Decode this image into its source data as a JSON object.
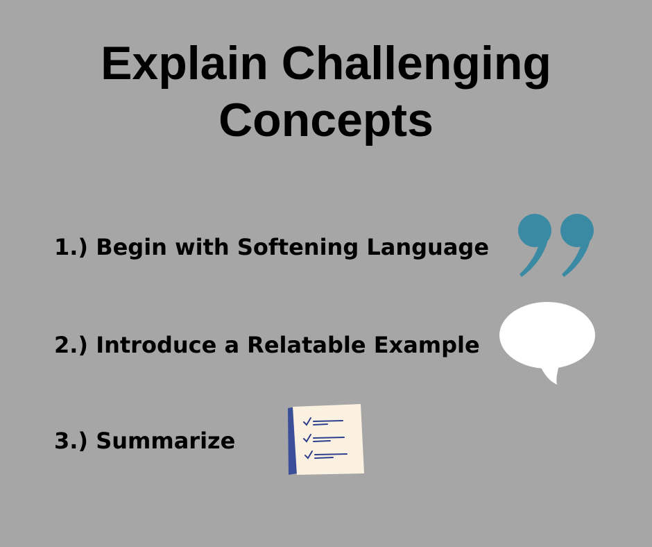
{
  "title": {
    "line1": "Explain Challenging",
    "line2": "Concepts"
  },
  "items": [
    {
      "label": "1.) Begin with Softening Language",
      "icon": "quotation-marks-icon"
    },
    {
      "label": "2.) Introduce a Relatable Example",
      "icon": "speech-bubble-icon"
    },
    {
      "label": "3.) Summarize",
      "icon": "checklist-note-icon"
    }
  ],
  "colors": {
    "background": "#a6a6a6",
    "text": "#000000",
    "quote_mark": "#3b8aa3",
    "speech_bubble": "#ffffff",
    "note_paper": "#fbf1e1",
    "note_edge": "#3a4f97",
    "note_ink": "#2d3f8c"
  }
}
